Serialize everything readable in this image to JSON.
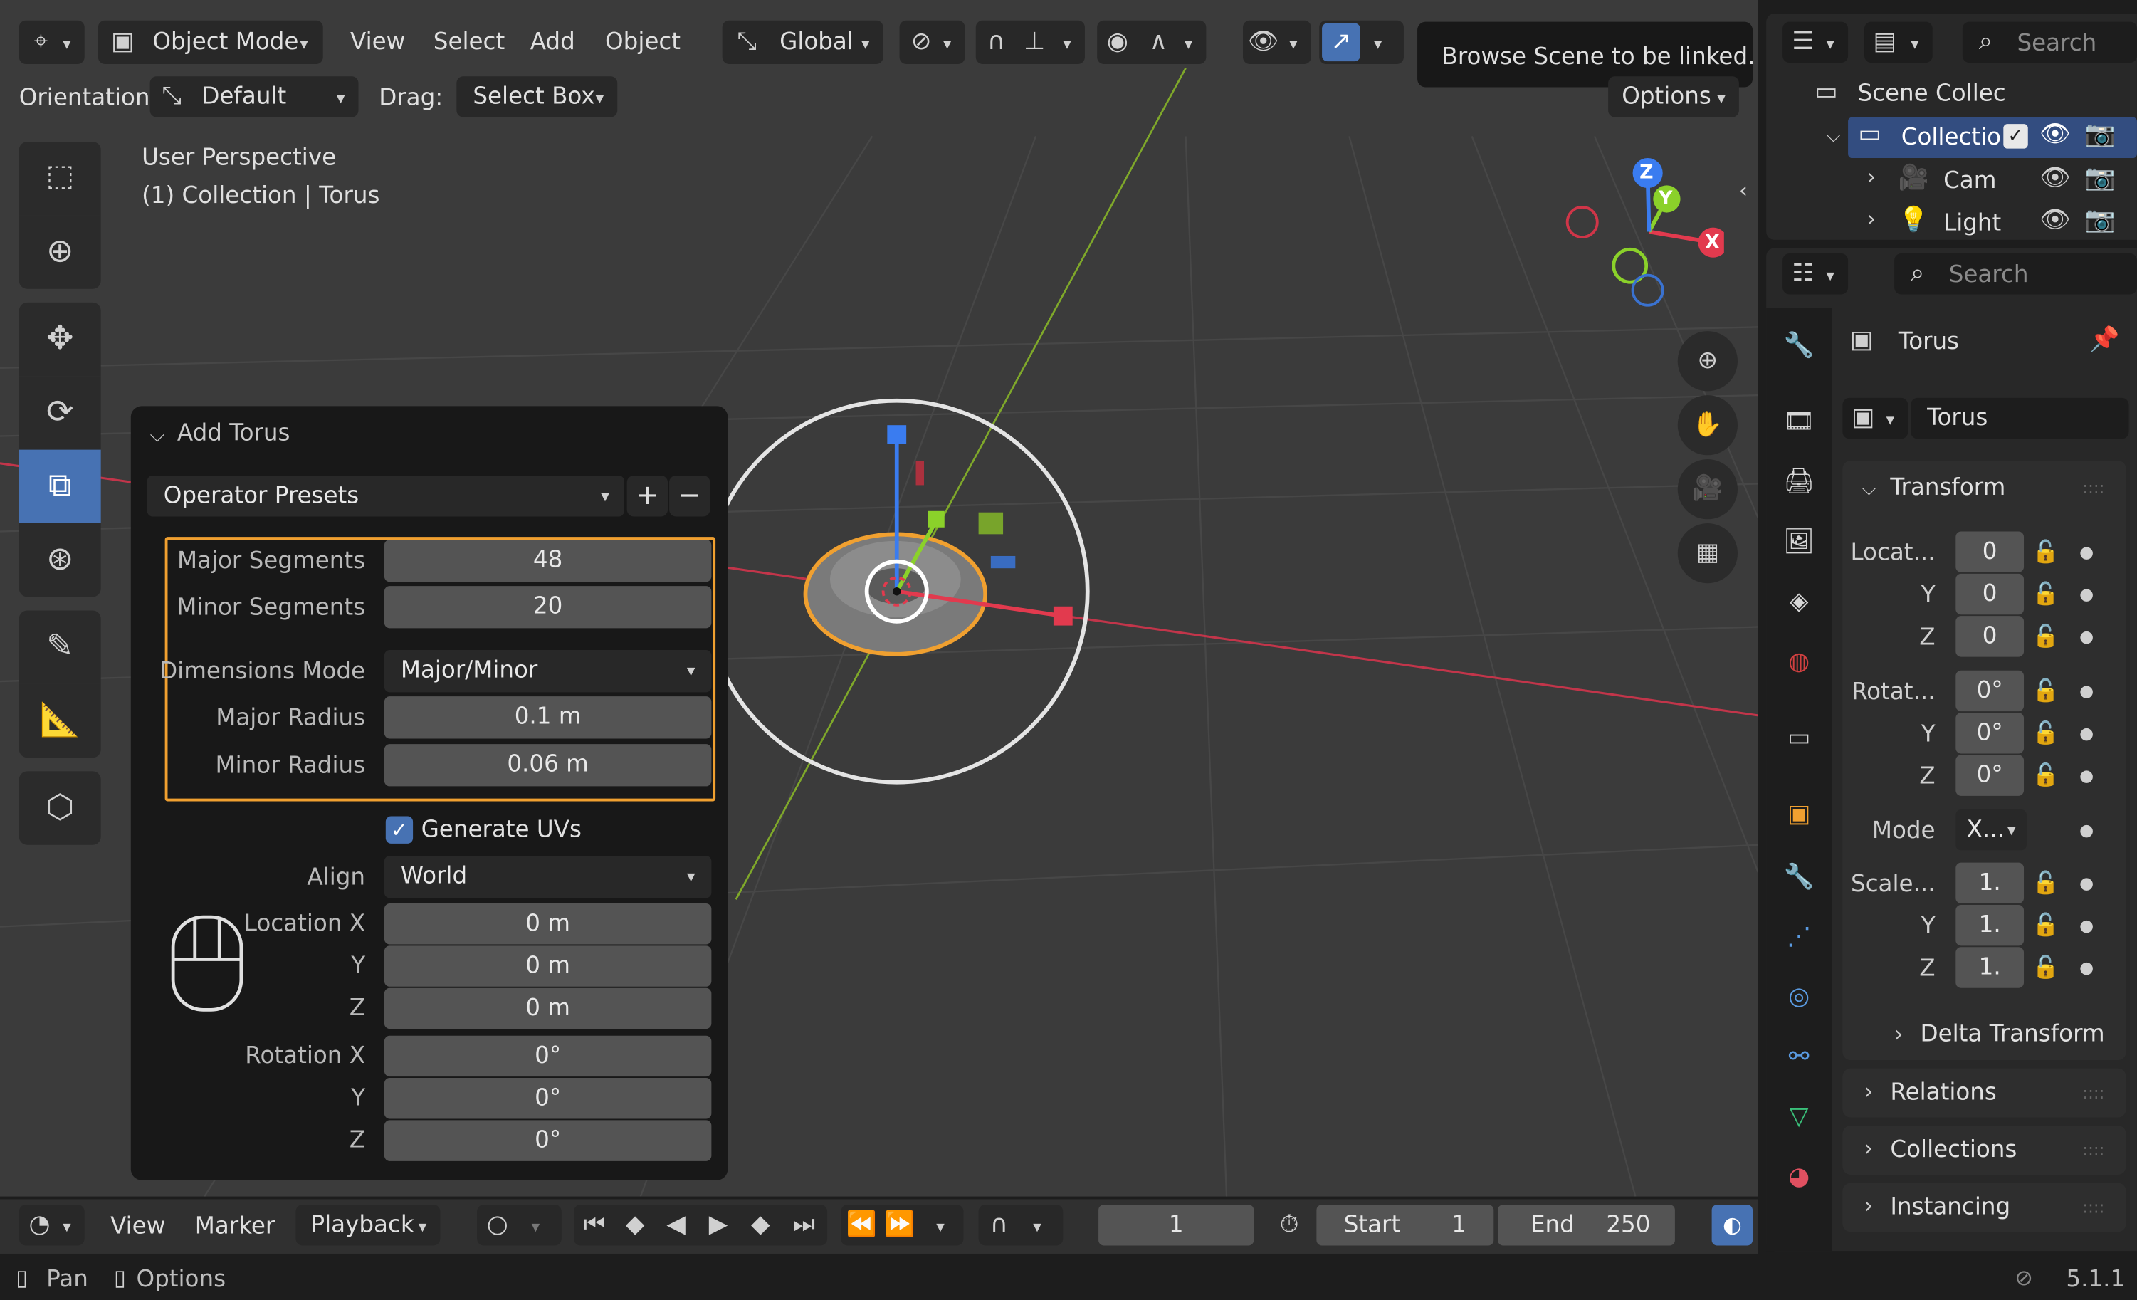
{
  "header": {
    "mode": "Object Mode",
    "menus": [
      "View",
      "Select",
      "Add",
      "Object"
    ],
    "transform_orientation": "Global",
    "tooltip": "Browse Scene to be linked."
  },
  "toolsettings": {
    "orientation_label": "Orientation:",
    "orientation_value": "Default",
    "drag_label": "Drag:",
    "drag_value": "Select Box",
    "options": "Options"
  },
  "viewport": {
    "perspective": "User Perspective",
    "collection_line": "(1) Collection | Torus",
    "gizmo_axes": [
      "Z",
      "Y",
      "X"
    ]
  },
  "operator_panel": {
    "title": "Add Torus",
    "presets": "Operator Presets",
    "major_segments_label": "Major Segments",
    "major_segments": "48",
    "minor_segments_label": "Minor Segments",
    "minor_segments": "20",
    "dimensions_mode_label": "Dimensions Mode",
    "dimensions_mode": "Major/Minor",
    "major_radius_label": "Major Radius",
    "major_radius": "0.1 m",
    "minor_radius_label": "Minor Radius",
    "minor_radius": "0.06 m",
    "generate_uvs": "Generate UVs",
    "align_label": "Align",
    "align": "World",
    "location_x_label": "Location X",
    "location_x": "0 m",
    "location_y_label": "Y",
    "location_y": "0 m",
    "location_z_label": "Z",
    "location_z": "0 m",
    "rotation_x_label": "Rotation X",
    "rotation_x": "0°",
    "rotation_y_label": "Y",
    "rotation_y": "0°",
    "rotation_z_label": "Z",
    "rotation_z": "0°"
  },
  "outliner": {
    "search_placeholder": "Search",
    "scene": "Scene Collec",
    "collection": "Collectio",
    "items": [
      "Cam",
      "Light"
    ]
  },
  "properties": {
    "search_placeholder": "Search",
    "object_name": "Torus",
    "data_name": "Torus",
    "transform_title": "Transform",
    "location_label": "Locat...",
    "rotation_label": "Rotat...",
    "scale_label": "Scale...",
    "mode_label": "Mode",
    "mode_value": "X...",
    "axis_y": "Y",
    "axis_z": "Z",
    "location": [
      "0",
      "0",
      "0"
    ],
    "rotation": [
      "0°",
      "0°",
      "0°"
    ],
    "scale": [
      "1.",
      "1.",
      "1."
    ],
    "subpanels": [
      "Delta Transform",
      "Relations",
      "Collections",
      "Instancing"
    ]
  },
  "timeline": {
    "menus": [
      "View",
      "Marker",
      "Playback"
    ],
    "current_frame": "1",
    "start_label": "Start",
    "start": "1",
    "end_label": "End",
    "end": "250"
  },
  "statusbar": {
    "pan": "Pan",
    "options": "Options",
    "version": "5.1.1"
  }
}
